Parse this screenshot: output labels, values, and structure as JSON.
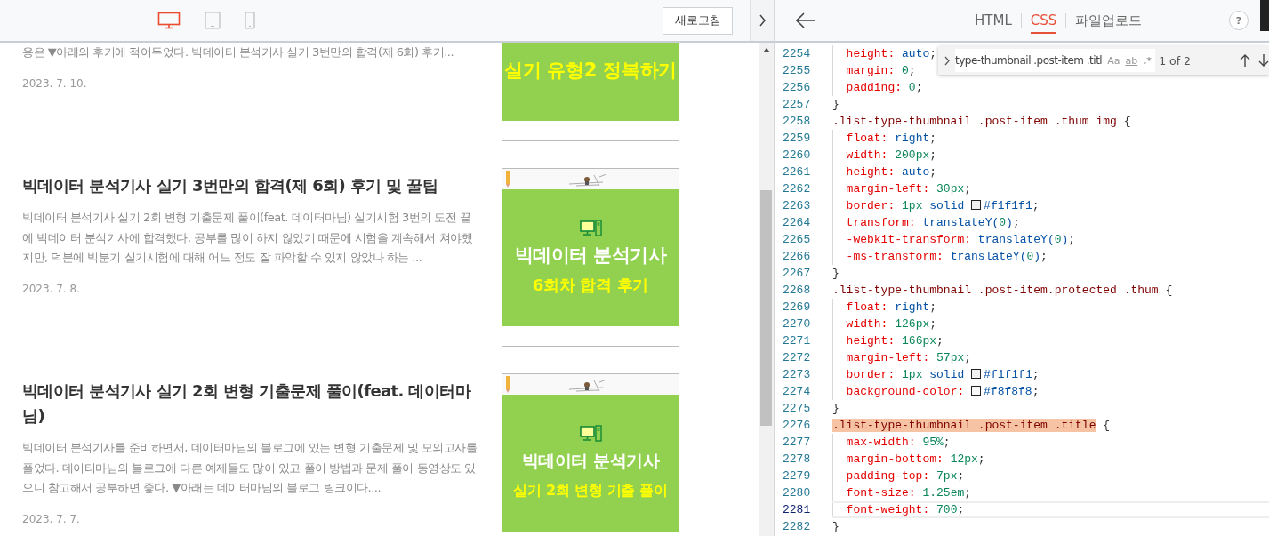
{
  "preview": {
    "devices": [
      {
        "kind": "desktop",
        "selected": true
      },
      {
        "kind": "tablet",
        "selected": false
      },
      {
        "kind": "phone",
        "selected": false
      }
    ],
    "refresh_button": "새로고침",
    "posts": [
      {
        "excerpt": "용은 ▼아래의 후기에 적어두었다. 빅데이터 분석기사 실기 3번만의 합격(제 6회) 후기...",
        "date": "2023. 7. 10.",
        "thumbnail": {
          "subtitle": "실기 유형2 정복하기"
        }
      },
      {
        "title": "빅데이터 분석기사 실기 3번만의 합격(제 6회) 후기 및 꿀팁",
        "excerpt": "빅데이터 분석기사 실기 2회 변형 기출문제 풀이(feat. 데이터마님) 실기시험 3번의 도전 끝에 빅데이터 분석기사에 합격했다. 공부를 많이 하지 않았기 때문에 시험을 계속해서 쳐야했지만, 덕분에 빅분기 실기시험에 대해 어느 정도 잘 파악할 수 있지 않았나 하는 ...",
        "date": "2023. 7. 8.",
        "thumbnail": {
          "title": "빅데이터 분석기사",
          "subtitle": "6회차 합격 후기"
        }
      },
      {
        "title": "빅데이터 분석기사 실기 2회 변형 기출문제 풀이(feat. 데이터마님)",
        "excerpt": "빅데이터 분석기사를 준비하면서, 데이터마님의 블로그에 있는 변형 기출문제 및 모의고사를 풀었다. 데이터마님의 블로그에 다른 예제들도 많이 있고 풀이 방법과 문제 풀이 동영상도 있으니 참고해서 공부하면 좋다. ▼아래는 데이터마님의 블로그 링크이다....",
        "date": "2023. 7. 7.",
        "thumbnail": {
          "title": "빅데이터 분석기사",
          "subtitle": "실기 2회 변형 기출 풀이"
        }
      }
    ]
  },
  "editor": {
    "tabs": [
      {
        "label": "HTML",
        "selected": false
      },
      {
        "label": "CSS",
        "selected": true
      },
      {
        "label": "파일업로드",
        "selected": false
      }
    ],
    "help": "?",
    "find": {
      "query": "type-thumbnail .post-item .titl",
      "options": [
        {
          "label": "Aa",
          "on": false
        },
        {
          "label": "ab",
          "on": false
        },
        {
          "label": ".*",
          "on": false
        }
      ],
      "result": "1 of 2"
    },
    "lines": [
      {
        "number": "2254",
        "text": "  height: auto;",
        "match": false,
        "current": false
      },
      {
        "number": "2255",
        "text": "  margin: 0;",
        "match": false,
        "current": false
      },
      {
        "number": "2256",
        "text": "  padding: 0;",
        "match": false,
        "current": false
      },
      {
        "number": "2257",
        "text": "}",
        "match": false,
        "current": false
      },
      {
        "number": "2258",
        "text": ".list-type-thumbnail .post-item .thum img {",
        "match": false,
        "current": false
      },
      {
        "number": "2259",
        "text": "  float: right;",
        "match": false,
        "current": false
      },
      {
        "number": "2260",
        "text": "  width: 200px;",
        "match": false,
        "current": false
      },
      {
        "number": "2261",
        "text": "  height: auto;",
        "match": false,
        "current": false
      },
      {
        "number": "2262",
        "text": "  margin-left: 30px;",
        "match": false,
        "current": false
      },
      {
        "number": "2263",
        "text": "  border: 1px solid #f1f1f1;",
        "match": false,
        "current": false
      },
      {
        "number": "2264",
        "text": "  transform: translateY(0);",
        "match": false,
        "current": false
      },
      {
        "number": "2265",
        "text": "  -webkit-transform: translateY(0);",
        "match": false,
        "current": false
      },
      {
        "number": "2266",
        "text": "  -ms-transform: translateY(0);",
        "match": false,
        "current": false
      },
      {
        "number": "2267",
        "text": "}",
        "match": false,
        "current": false
      },
      {
        "number": "2268",
        "text": ".list-type-thumbnail .post-item.protected .thum {",
        "match": false,
        "current": false
      },
      {
        "number": "2269",
        "text": "  float: right;",
        "match": false,
        "current": false
      },
      {
        "number": "2270",
        "text": "  width: 126px;",
        "match": false,
        "current": false
      },
      {
        "number": "2271",
        "text": "  height: 166px;",
        "match": false,
        "current": false
      },
      {
        "number": "2272",
        "text": "  margin-left: 57px;",
        "match": false,
        "current": false
      },
      {
        "number": "2273",
        "text": "  border: 1px solid #f1f1f1;",
        "match": false,
        "current": false
      },
      {
        "number": "2274",
        "text": "  background-color: #f8f8f8;",
        "match": false,
        "current": false
      },
      {
        "number": "2275",
        "text": "}",
        "match": false,
        "current": false
      },
      {
        "number": "2276",
        "text": ".list-type-thumbnail .post-item .title {",
        "match": true,
        "current": false
      },
      {
        "number": "2277",
        "text": "  max-width: 95%;",
        "match": false,
        "current": false
      },
      {
        "number": "2278",
        "text": "  margin-bottom: 12px;",
        "match": false,
        "current": false
      },
      {
        "number": "2279",
        "text": "  padding-top: 7px;",
        "match": false,
        "current": false
      },
      {
        "number": "2280",
        "text": "  font-size: 1.25em;",
        "match": false,
        "current": false
      },
      {
        "number": "2281",
        "text": "  font-weight: 700;",
        "match": false,
        "current": true
      },
      {
        "number": "2282",
        "text": "}",
        "match": false,
        "current": false
      }
    ]
  }
}
